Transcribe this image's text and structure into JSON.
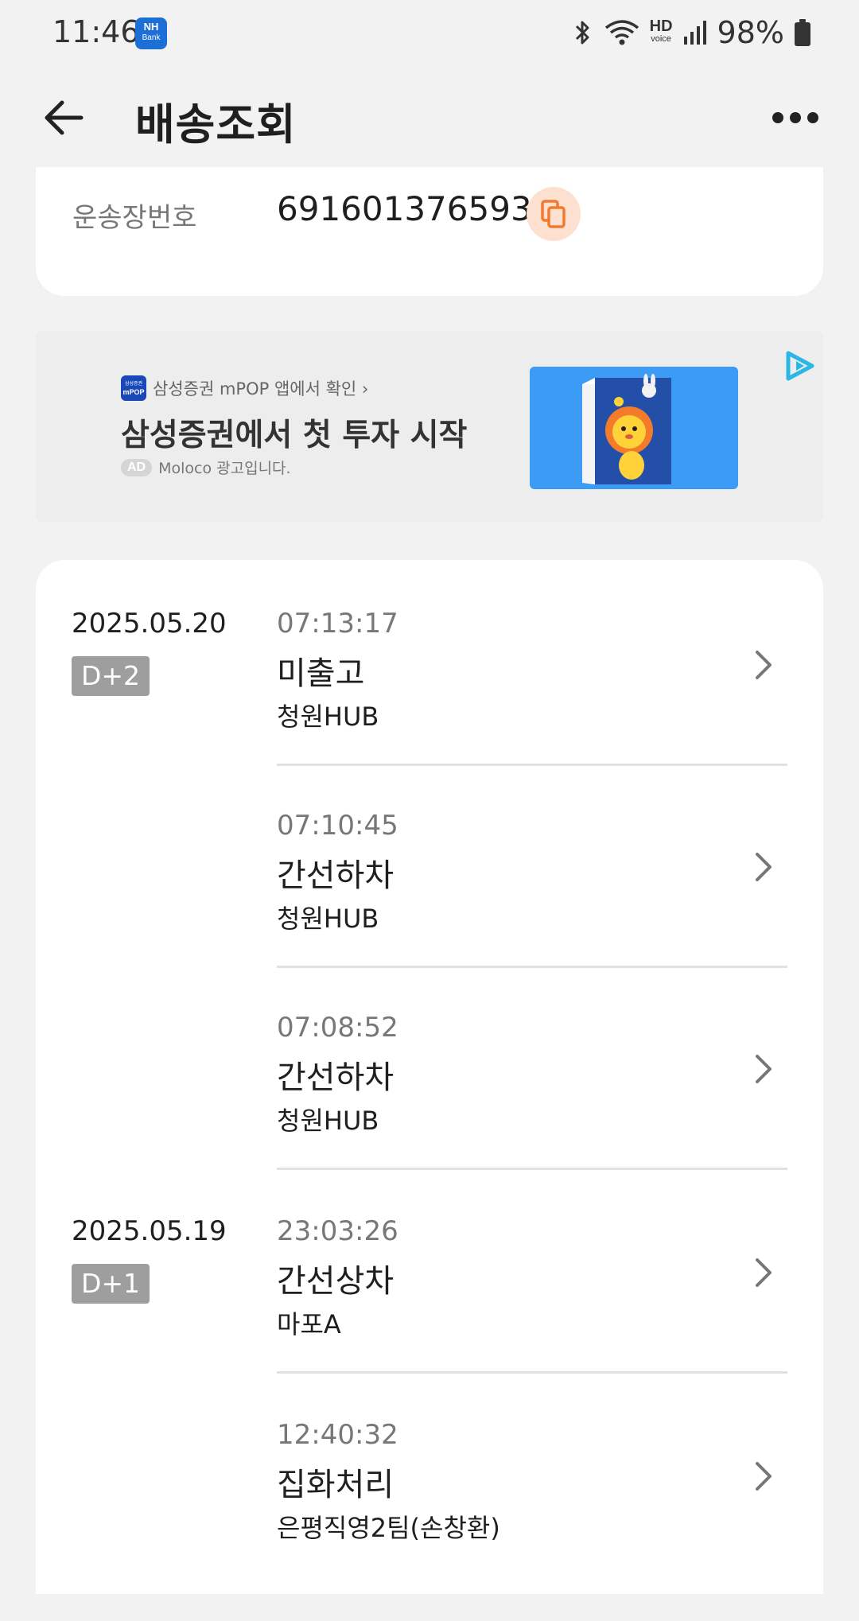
{
  "status_bar": {
    "time": "11:46",
    "app_icon": {
      "line1": "NH",
      "line2": "Bank"
    },
    "hd_label": "HD",
    "hd_sub": "voice",
    "battery": "98%"
  },
  "header": {
    "title": "배송조회"
  },
  "waybill": {
    "label": "운송장번호",
    "number": "691601376593"
  },
  "ad": {
    "app_icon_line1": "삼성증권",
    "app_icon_line2": "mPOP",
    "app_text": "삼성증권 mPOP 앱에서 확인 ›",
    "headline": "삼성증권에서 첫 투자 시작",
    "badge": "AD",
    "sponsor": "Moloco 광고입니다."
  },
  "tracking": {
    "groups": [
      {
        "date": "2025.05.20",
        "day": "D+2",
        "events": [
          {
            "time": "07:13:17",
            "status": "미출고",
            "location": "청원HUB"
          },
          {
            "time": "07:10:45",
            "status": "간선하차",
            "location": "청원HUB"
          },
          {
            "time": "07:08:52",
            "status": "간선하차",
            "location": "청원HUB"
          }
        ]
      },
      {
        "date": "2025.05.19",
        "day": "D+1",
        "events": [
          {
            "time": "23:03:26",
            "status": "간선상차",
            "location": "마포A"
          },
          {
            "time": "12:40:32",
            "status": "집화처리",
            "location": "은평직영2팀(손창환)"
          }
        ]
      }
    ]
  },
  "colors": {
    "background": "#f2f2f2",
    "card": "#ffffff",
    "accent_orange": "#f07a2f",
    "badge_gray": "#9e9e9e"
  }
}
